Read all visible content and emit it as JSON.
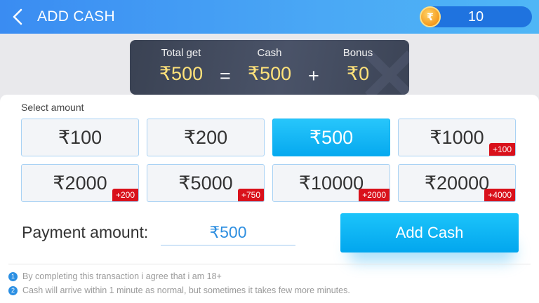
{
  "header": {
    "title": "ADD CASH",
    "coin_symbol": "₹",
    "coin_count": "10"
  },
  "summary": {
    "total_label": "Total get",
    "total_value": "₹500",
    "equals": "=",
    "cash_label": "Cash",
    "cash_value": "₹500",
    "plus": "+",
    "bonus_label": "Bonus",
    "bonus_value": "₹0"
  },
  "select_label": "Select amount",
  "amounts": [
    {
      "label": "₹100",
      "bonus": ""
    },
    {
      "label": "₹200",
      "bonus": ""
    },
    {
      "label": "₹500",
      "bonus": "",
      "selected": true
    },
    {
      "label": "₹1000",
      "bonus": "+100"
    },
    {
      "label": "₹2000",
      "bonus": "+200"
    },
    {
      "label": "₹5000",
      "bonus": "+750"
    },
    {
      "label": "₹10000",
      "bonus": "+2000"
    },
    {
      "label": "₹20000",
      "bonus": "+4000"
    }
  ],
  "payment": {
    "label": "Payment amount:",
    "value": "₹500"
  },
  "add_cash_label": "Add Cash",
  "notes": [
    {
      "num": "1",
      "text": "By completing this transaction i agree that i am 18+"
    },
    {
      "num": "2",
      "text": "Cash will arrive within 1 minute as normal, but sometimes it takes few more minutes."
    }
  ],
  "colors": {
    "accent": "#06a9ef",
    "header": "#3a8cf2",
    "bonus_tag": "#d9111b",
    "gold": "#ffe27a"
  }
}
